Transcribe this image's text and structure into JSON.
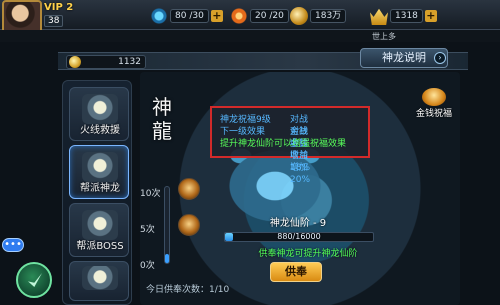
{
  "top": {
    "vip": "VIP 2",
    "level": "38",
    "stamina": "80 /30",
    "energy": "20 /20",
    "gold": "183万",
    "diamonds": "1318",
    "world_label": "世上多"
  },
  "panel": {
    "currency_value": "1132",
    "explain_button": "神龙说明"
  },
  "menu": {
    "items": [
      {
        "label": "火线救援"
      },
      {
        "label": "帮派神龙"
      },
      {
        "label": "帮派BOSS"
      }
    ]
  },
  "scene": {
    "calligraphy": [
      "神",
      "龍"
    ],
    "blessing_label": "金钱祝福",
    "tooltip": {
      "line1_left": "神龙祝福9级",
      "line1_right": "对战金钱收益增加18%",
      "line2_left": "下一级效果",
      "line2_right": "对战金钱收益增加20%",
      "line3": "提升神龙仙阶可以增强祝福效果"
    },
    "gauge": {
      "ticks": [
        "10次",
        "5次",
        "0次"
      ],
      "fill_percent": 12
    },
    "dragon_level_label": "神龙仙阶 - 9",
    "progress": {
      "text": "880/16000",
      "fraction": 0.055
    },
    "upgrade_hint": "供奉神龙可提升神龙仙阶",
    "action_button": "供奉",
    "today_text": "今日供奉次数：1/10"
  },
  "floating": {
    "chat_bubble": "•••"
  }
}
